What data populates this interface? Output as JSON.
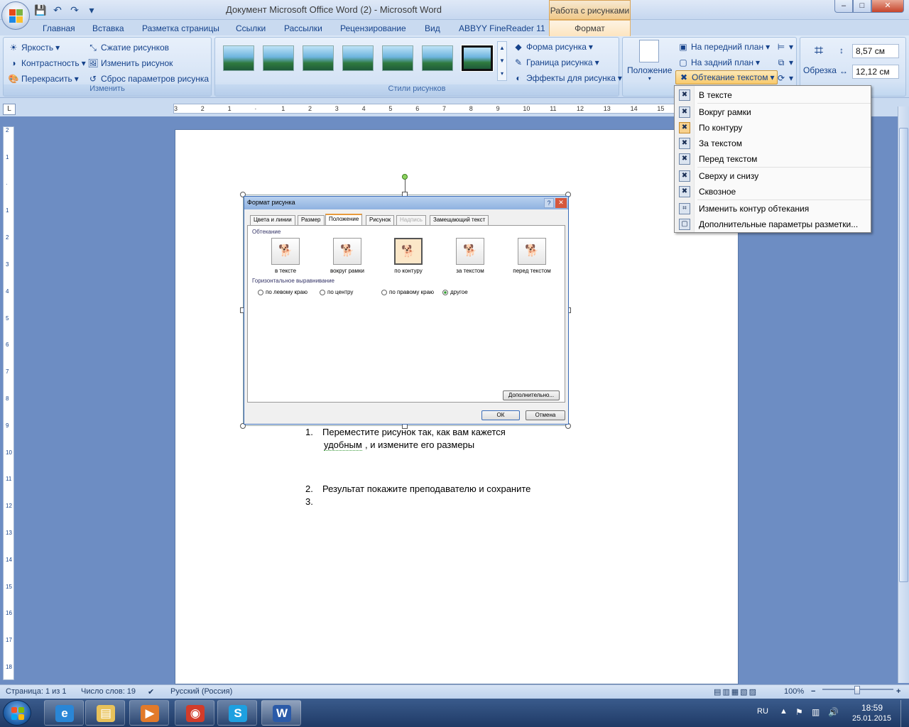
{
  "window": {
    "title": "Документ Microsoft Office Word (2)  -  Microsoft Word",
    "context_tools": "Работа с рисунками",
    "controls": {
      "minimize": "–",
      "maximize": "□",
      "close": "✕"
    }
  },
  "qat": {
    "save": "💾",
    "undo": "↶",
    "redo": "↷",
    "customize": "▾"
  },
  "tabs": [
    "Главная",
    "Вставка",
    "Разметка страницы",
    "Ссылки",
    "Рассылки",
    "Рецензирование",
    "Вид",
    "ABBYY FineReader 11"
  ],
  "active_tab": "Формат",
  "ribbon": {
    "adjust": {
      "label": "Изменить",
      "brightness": "Яркость",
      "contrast": "Контрастность",
      "recolor": "Перекрасить",
      "compress": "Сжатие рисунков",
      "change": "Изменить рисунок",
      "reset": "Сброс параметров рисунка"
    },
    "styles": {
      "label": "Стили рисунков",
      "shape": "Форма рисунка",
      "border": "Граница рисунка",
      "effects": "Эффекты для рисунка"
    },
    "arrange": {
      "position": "Положение",
      "bring_front": "На передний план",
      "send_back": "На задний план",
      "text_wrap": "Обтекание текстом"
    },
    "size": {
      "crop": "Обрезка",
      "height": "8,57 см",
      "width": "12,12 см"
    }
  },
  "ruler_marks": [
    "3",
    "2",
    "1",
    "",
    "1",
    "2",
    "3",
    "4",
    "5",
    "6",
    "7",
    "8",
    "9",
    "10",
    "11",
    "12",
    "13",
    "14",
    "15"
  ],
  "vruler_marks": [
    "2",
    "1",
    "",
    "1",
    "2",
    "3",
    "4",
    "5",
    "6",
    "7",
    "8",
    "9",
    "10",
    "11",
    "12",
    "13",
    "14",
    "15",
    "16",
    "17",
    "18"
  ],
  "wrap_menu": {
    "items": [
      "В тексте",
      "Вокруг рамки",
      "По контуру",
      "За текстом",
      "Перед текстом",
      "Сверху и снизу",
      "Сквозное",
      "Изменить контур обтекания",
      "Дополнительные параметры разметки..."
    ]
  },
  "dialog": {
    "title": "Формат рисунка",
    "help": "?",
    "close": "✕",
    "tabs": [
      "Цвета и линии",
      "Размер",
      "Положение",
      "Рисунок",
      "Надпись",
      "Замещающий текст"
    ],
    "section_wrap": "Обтекание",
    "wrap_options": [
      "в тексте",
      "вокруг рамки",
      "по контуру",
      "за текстом",
      "перед текстом"
    ],
    "section_align": "Горизонтальное выравнивание",
    "align_options": [
      "по левому краю",
      "по центру",
      "по правому краю",
      "другое"
    ],
    "more": "Дополнительно...",
    "ok": "ОК",
    "cancel": "Отмена"
  },
  "document": {
    "item1_num": "1.",
    "item1_line1": "Переместите рисунок так, как вам кажется",
    "item1_line2a": "удобным",
    "item1_line2b": ", и измените его размеры",
    "item2_num": "2.",
    "item2": "Результат покажите   преподавателю и сохраните",
    "item3_num": "3."
  },
  "status": {
    "page": "Страница: 1 из 1",
    "words": "Число слов: 19",
    "language": "Русский (Россия)",
    "zoom": "100%",
    "zoom_minus": "−",
    "zoom_plus": "+"
  },
  "taskbar": {
    "lang": "RU",
    "time": "18:59",
    "date": "25.01.2015",
    "apps": [
      {
        "name": "ie",
        "glyph": "e",
        "color": "#2a86d6"
      },
      {
        "name": "explorer",
        "glyph": "▤",
        "color": "#e8c25a"
      },
      {
        "name": "media",
        "glyph": "▶",
        "color": "#e27a2a"
      },
      {
        "name": "chrome",
        "glyph": "◉",
        "color": "#d23c2a"
      },
      {
        "name": "skype",
        "glyph": "S",
        "color": "#1ea0e0"
      },
      {
        "name": "word",
        "glyph": "W",
        "color": "#2b5aa8"
      }
    ]
  }
}
